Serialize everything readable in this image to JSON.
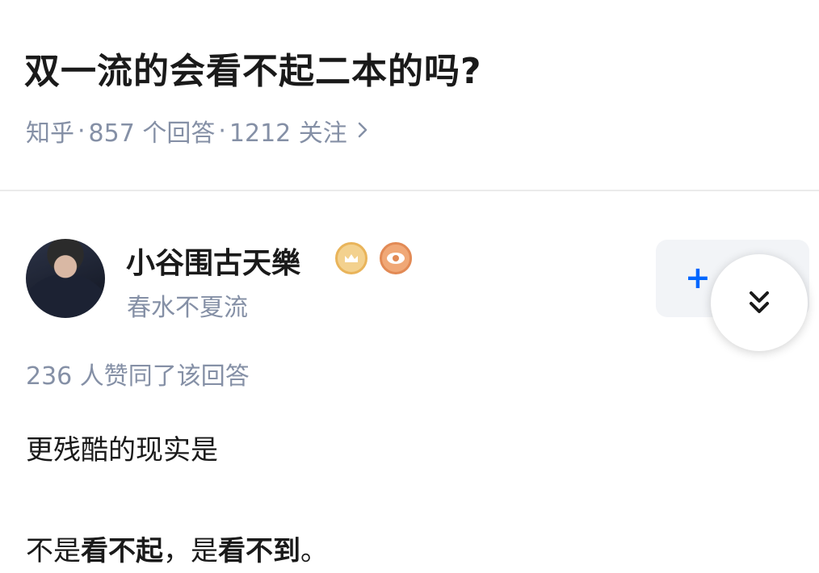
{
  "question": {
    "title": "双一流的会看不起二本的吗?",
    "source": "知乎",
    "answers_count": "857 个回答",
    "followers_count": "1212 关注",
    "separator": "·",
    "chevron_icon": "chevron-right-icon"
  },
  "author": {
    "name": "小谷围古天樂",
    "bio": "春水不夏流",
    "badges": [
      "crown-badge-icon",
      "eye-badge-icon"
    ],
    "follow_label": "+"
  },
  "answer": {
    "vote_summary": "236 人赞同了该回答",
    "line1": "更残酷的现实是",
    "line2_part1": "不是",
    "line2_bold1": "看不起",
    "line2_part2": "，是",
    "line2_bold2": "看不到",
    "line2_end": "。"
  },
  "colors": {
    "accent": "#0066ff",
    "meta_gray": "#8590a6",
    "text": "#1a1a1a"
  }
}
